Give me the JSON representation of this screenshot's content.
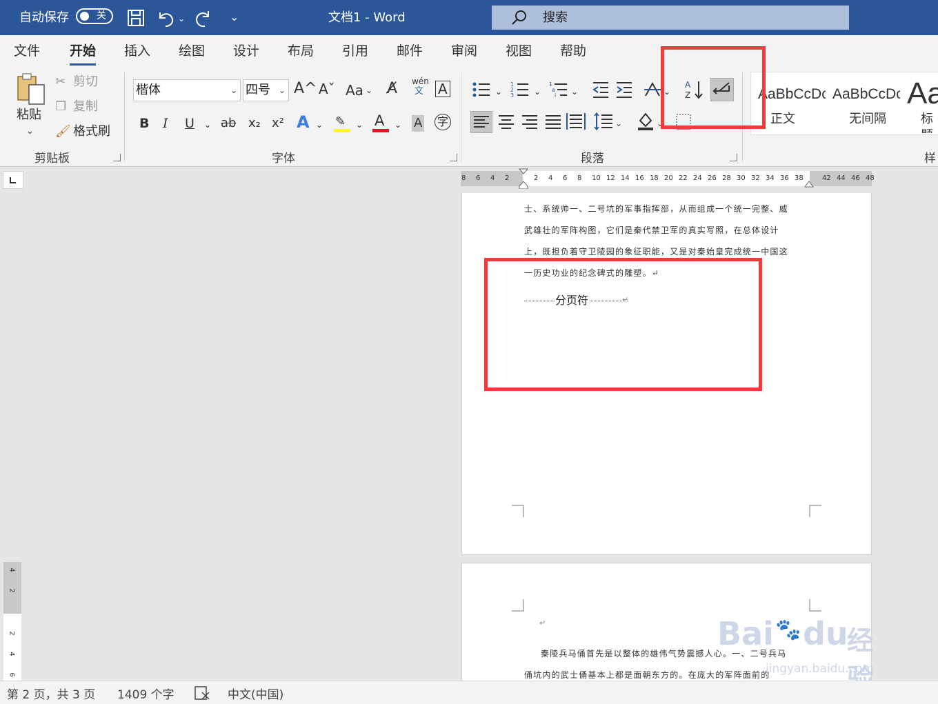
{
  "titlebar": {
    "autosave_label": "自动保存",
    "autosave_state": "关",
    "doc_title": "文档1  -  Word",
    "search_label": "搜索"
  },
  "menu": {
    "tabs": [
      "文件",
      "开始",
      "插入",
      "绘图",
      "设计",
      "布局",
      "引用",
      "邮件",
      "审阅",
      "视图",
      "帮助"
    ],
    "active_tab": "开始"
  },
  "clipboard": {
    "paste": "粘贴",
    "cut": "剪切",
    "copy": "复制",
    "format_painter": "格式刷",
    "group_label": "剪贴板"
  },
  "font": {
    "font_name": "楷体",
    "font_size": "四号",
    "change_case": "Aa",
    "phonetic_top": "wén",
    "phonetic_bottom": "文",
    "enclose": "字",
    "group_label": "字体",
    "bold": "B",
    "italic": "I",
    "underline": "U",
    "strike": "ab",
    "subscript": "x₂",
    "superscript": "x²",
    "text_effects": "A",
    "font_color": "A",
    "char_shade": "A",
    "grow": "A^",
    "shrink": "Aˇ"
  },
  "paragraph": {
    "group_label": "段落"
  },
  "styles": {
    "items": [
      {
        "preview": "AaBbCcDc",
        "label": "正文"
      },
      {
        "preview": "AaBbCcDc",
        "label": "无间隔"
      },
      {
        "preview": "Aa",
        "label": "标题"
      }
    ],
    "group_label": "样"
  },
  "ruler": {
    "h_left": [
      "8",
      "6",
      "4",
      "2"
    ],
    "h_main": [
      "2",
      "4",
      "6",
      "8",
      "10",
      "12",
      "14",
      "16",
      "18",
      "20",
      "22",
      "24",
      "26",
      "28",
      "30",
      "32",
      "34",
      "36",
      "38"
    ],
    "h_right": [
      "42",
      "44",
      "46",
      "48"
    ],
    "v_gray": [
      "4",
      "2"
    ],
    "v_white": [
      "2",
      "4",
      "6"
    ]
  },
  "document": {
    "page1_lines": [
      "士、系统帅一、二号坑的军事指挥部，从而组成一个统一完整、威",
      "武雄壮的军阵构图，它们是秦代禁卫军的真实写照，在总体设计",
      "上，既担负着守卫陵园的象征职能，又是对秦始皇完成统一中国这",
      "一历史功业的纪念碑式的雕塑。↵"
    ],
    "page_break_label": "分页符",
    "page2_mark": "↵",
    "page2_lines": [
      "秦陵兵马俑首先是以整体的雄伟气势震撼人心。一、二号兵马",
      "俑坑内的武士俑基本上都是面朝东方的。在庞大的军阵面前的"
    ]
  },
  "watermark": {
    "brand": "Bai",
    "brand2": "du",
    "cn": "经验",
    "url": "jingyan.baidu.com"
  },
  "status": {
    "page": "第 2 页，共 3 页",
    "words": "1409 个字",
    "language": "中文(中国)"
  },
  "colors": {
    "title_blue": "#2b579a",
    "highlight_red": "#ee3b3b",
    "ribbon_bg": "#f3f3f3"
  }
}
